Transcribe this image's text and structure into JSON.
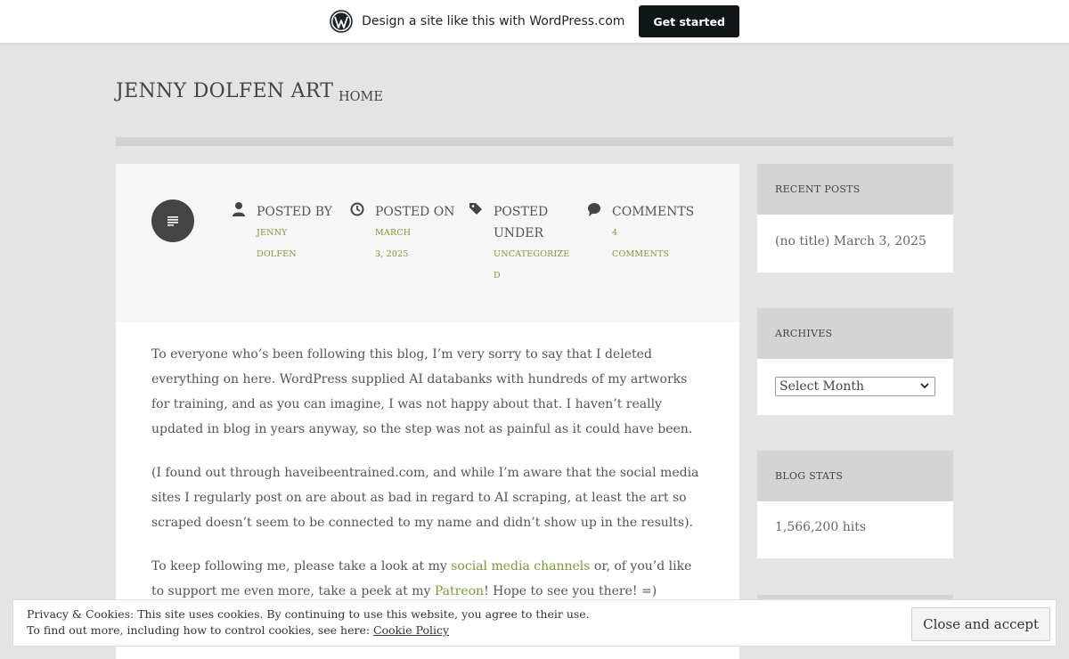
{
  "wpbar": {
    "text": "Design a site like this with WordPress.com",
    "button": "Get started"
  },
  "header": {
    "site_title": "JENNY DOLFEN ART",
    "nav": [
      "HOME"
    ]
  },
  "meta": {
    "posted_by_label": "POSTED BY",
    "posted_by_value": "JENNY DOLFEN",
    "posted_on_label": "POSTED ON",
    "posted_on_value": "MARCH 3, 2025",
    "posted_under_label_1": "POSTED",
    "posted_under_label_2": "UNDER",
    "category_1": "UNCATEGORIZE",
    "category_2": "D",
    "comments_label": "COMMENTS",
    "comments_value": "4 COMMENTS"
  },
  "content": {
    "p1": "To everyone who’s been following this blog, I’m very sorry to say that I deleted everything on here. WordPress supplied AI databanks with hundreds of my artworks for training, and as you can imagine, I was not happy about that. I haven’t really updated in blog in years anyway, so the step was not as painful as it could have been.",
    "p2": "(I found out through haveibeentrained.com, and while I’m aware that the social media sites I regularly post on are about as bad in regard to AI scraping, at least the art so scraped doesn’t seem to be connected to my name and didn’t show up in the results).",
    "p3_a": "To keep following me, please take a look at my ",
    "p3_link1": "social media channels",
    "p3_b": " or, of you’d like to support me even more, take a peek at my ",
    "p3_link2": "Patreon",
    "p3_c": "! Hope to see you there! =)"
  },
  "sidebar": {
    "recent_posts_title": "RECENT POSTS",
    "recent_post": "(no title) March 3, 2025",
    "archives_title": "ARCHIVES",
    "archives_select": "Select Month",
    "stats_title": "BLOG STATS",
    "stats_value": "1,566,200 hits"
  },
  "cookie": {
    "line1": "Privacy & Cookies: This site uses cookies. By continuing to use this website, you agree to their use.",
    "line2_prefix": "To find out more, including how to control cookies, see here: ",
    "link": "Cookie Policy",
    "button": "Close and accept"
  },
  "colors": {
    "accent_link": "#7a9a3a",
    "background": "#e4e4e4",
    "widget_header": "#d4d4d4"
  }
}
